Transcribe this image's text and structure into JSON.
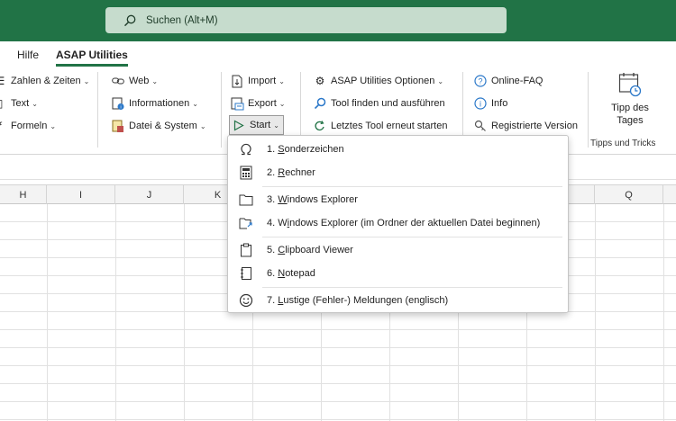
{
  "search": {
    "placeholder_text": "Suchen (Alt+M)"
  },
  "tabs": [
    "Hilfe",
    "ASAP Utilities"
  ],
  "ribbon": {
    "col1": [
      "Zahlen & Zeiten",
      "Text",
      "Formeln"
    ],
    "col2": [
      "Web",
      "Informationen",
      "Datei & System"
    ],
    "col3": [
      "Import",
      "Export",
      "Start"
    ],
    "col4": [
      "ASAP Utilities Optionen",
      "Tool finden und ausführen",
      "Letztes Tool erneut starten"
    ],
    "col5": [
      "Online-FAQ",
      "Info",
      "Registrierte Version"
    ],
    "tipp": {
      "line1": "Tipp des",
      "line2": "Tages"
    },
    "group_label": "Tipps und Tricks"
  },
  "columns": [
    "H",
    "I",
    "J",
    "K",
    "Q"
  ],
  "menu": {
    "items": [
      {
        "prefix": "1. ",
        "ul": "S",
        "rest": "onderzeichen",
        "icon": "omega-icon"
      },
      {
        "prefix": "2. ",
        "ul": "R",
        "rest": "echner",
        "icon": "calculator-icon"
      },
      {
        "prefix": "3. ",
        "ul": "W",
        "rest": "indows Explorer",
        "icon": "folder-icon"
      },
      {
        "prefix": "4. W",
        "ul": "i",
        "rest": "ndows Explorer (im Ordner der aktuellen Datei beginnen)",
        "icon": "folder-arrow-icon"
      },
      {
        "prefix": "5. ",
        "ul": "C",
        "rest": "lipboard Viewer",
        "icon": "clipboard-icon"
      },
      {
        "prefix": "6. ",
        "ul": "N",
        "rest": "otepad",
        "icon": "notepad-icon"
      },
      {
        "prefix": "7. ",
        "ul": "L",
        "rest": "ustige (Fehler-) Meldungen (englisch)",
        "icon": "smiley-icon"
      }
    ]
  },
  "colors": {
    "title_bar": "#217346",
    "search_bg": "#c6dccd"
  }
}
